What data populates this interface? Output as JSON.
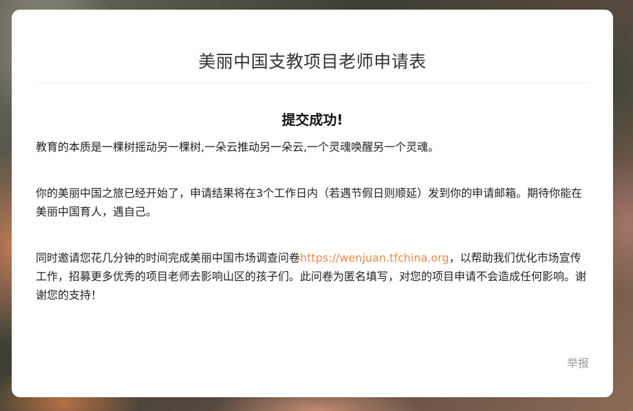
{
  "form": {
    "title": "美丽中国支教项目老师申请表"
  },
  "result": {
    "heading": "提交成功!",
    "paragraph1": "教育的本质是一棵树摇动另一棵树,一朵云推动另一朵云,一个灵魂唤醒另一个灵魂。",
    "paragraph2": "你的美丽中国之旅已经开始了，申请结果将在3个工作日内（若遇节假日则顺延）发到你的申请邮箱。期待你能在美丽中国育人，遇自己。",
    "paragraph3_before": "同时邀请您花几分钟的时间完成美丽中国市场调查问卷",
    "paragraph3_link": "https://wenjuan.tfchina.org",
    "paragraph3_after": "，以帮助我们优化市场宣传工作，招募更多优秀的项目老师去影响山区的孩子们。此问卷为匿名填写，对您的项目申请不会造成任何影响。谢谢您的支持！"
  },
  "footer": {
    "report_label": "举报"
  },
  "colors": {
    "link": "#e8894c",
    "card_background": "#ffffff"
  }
}
